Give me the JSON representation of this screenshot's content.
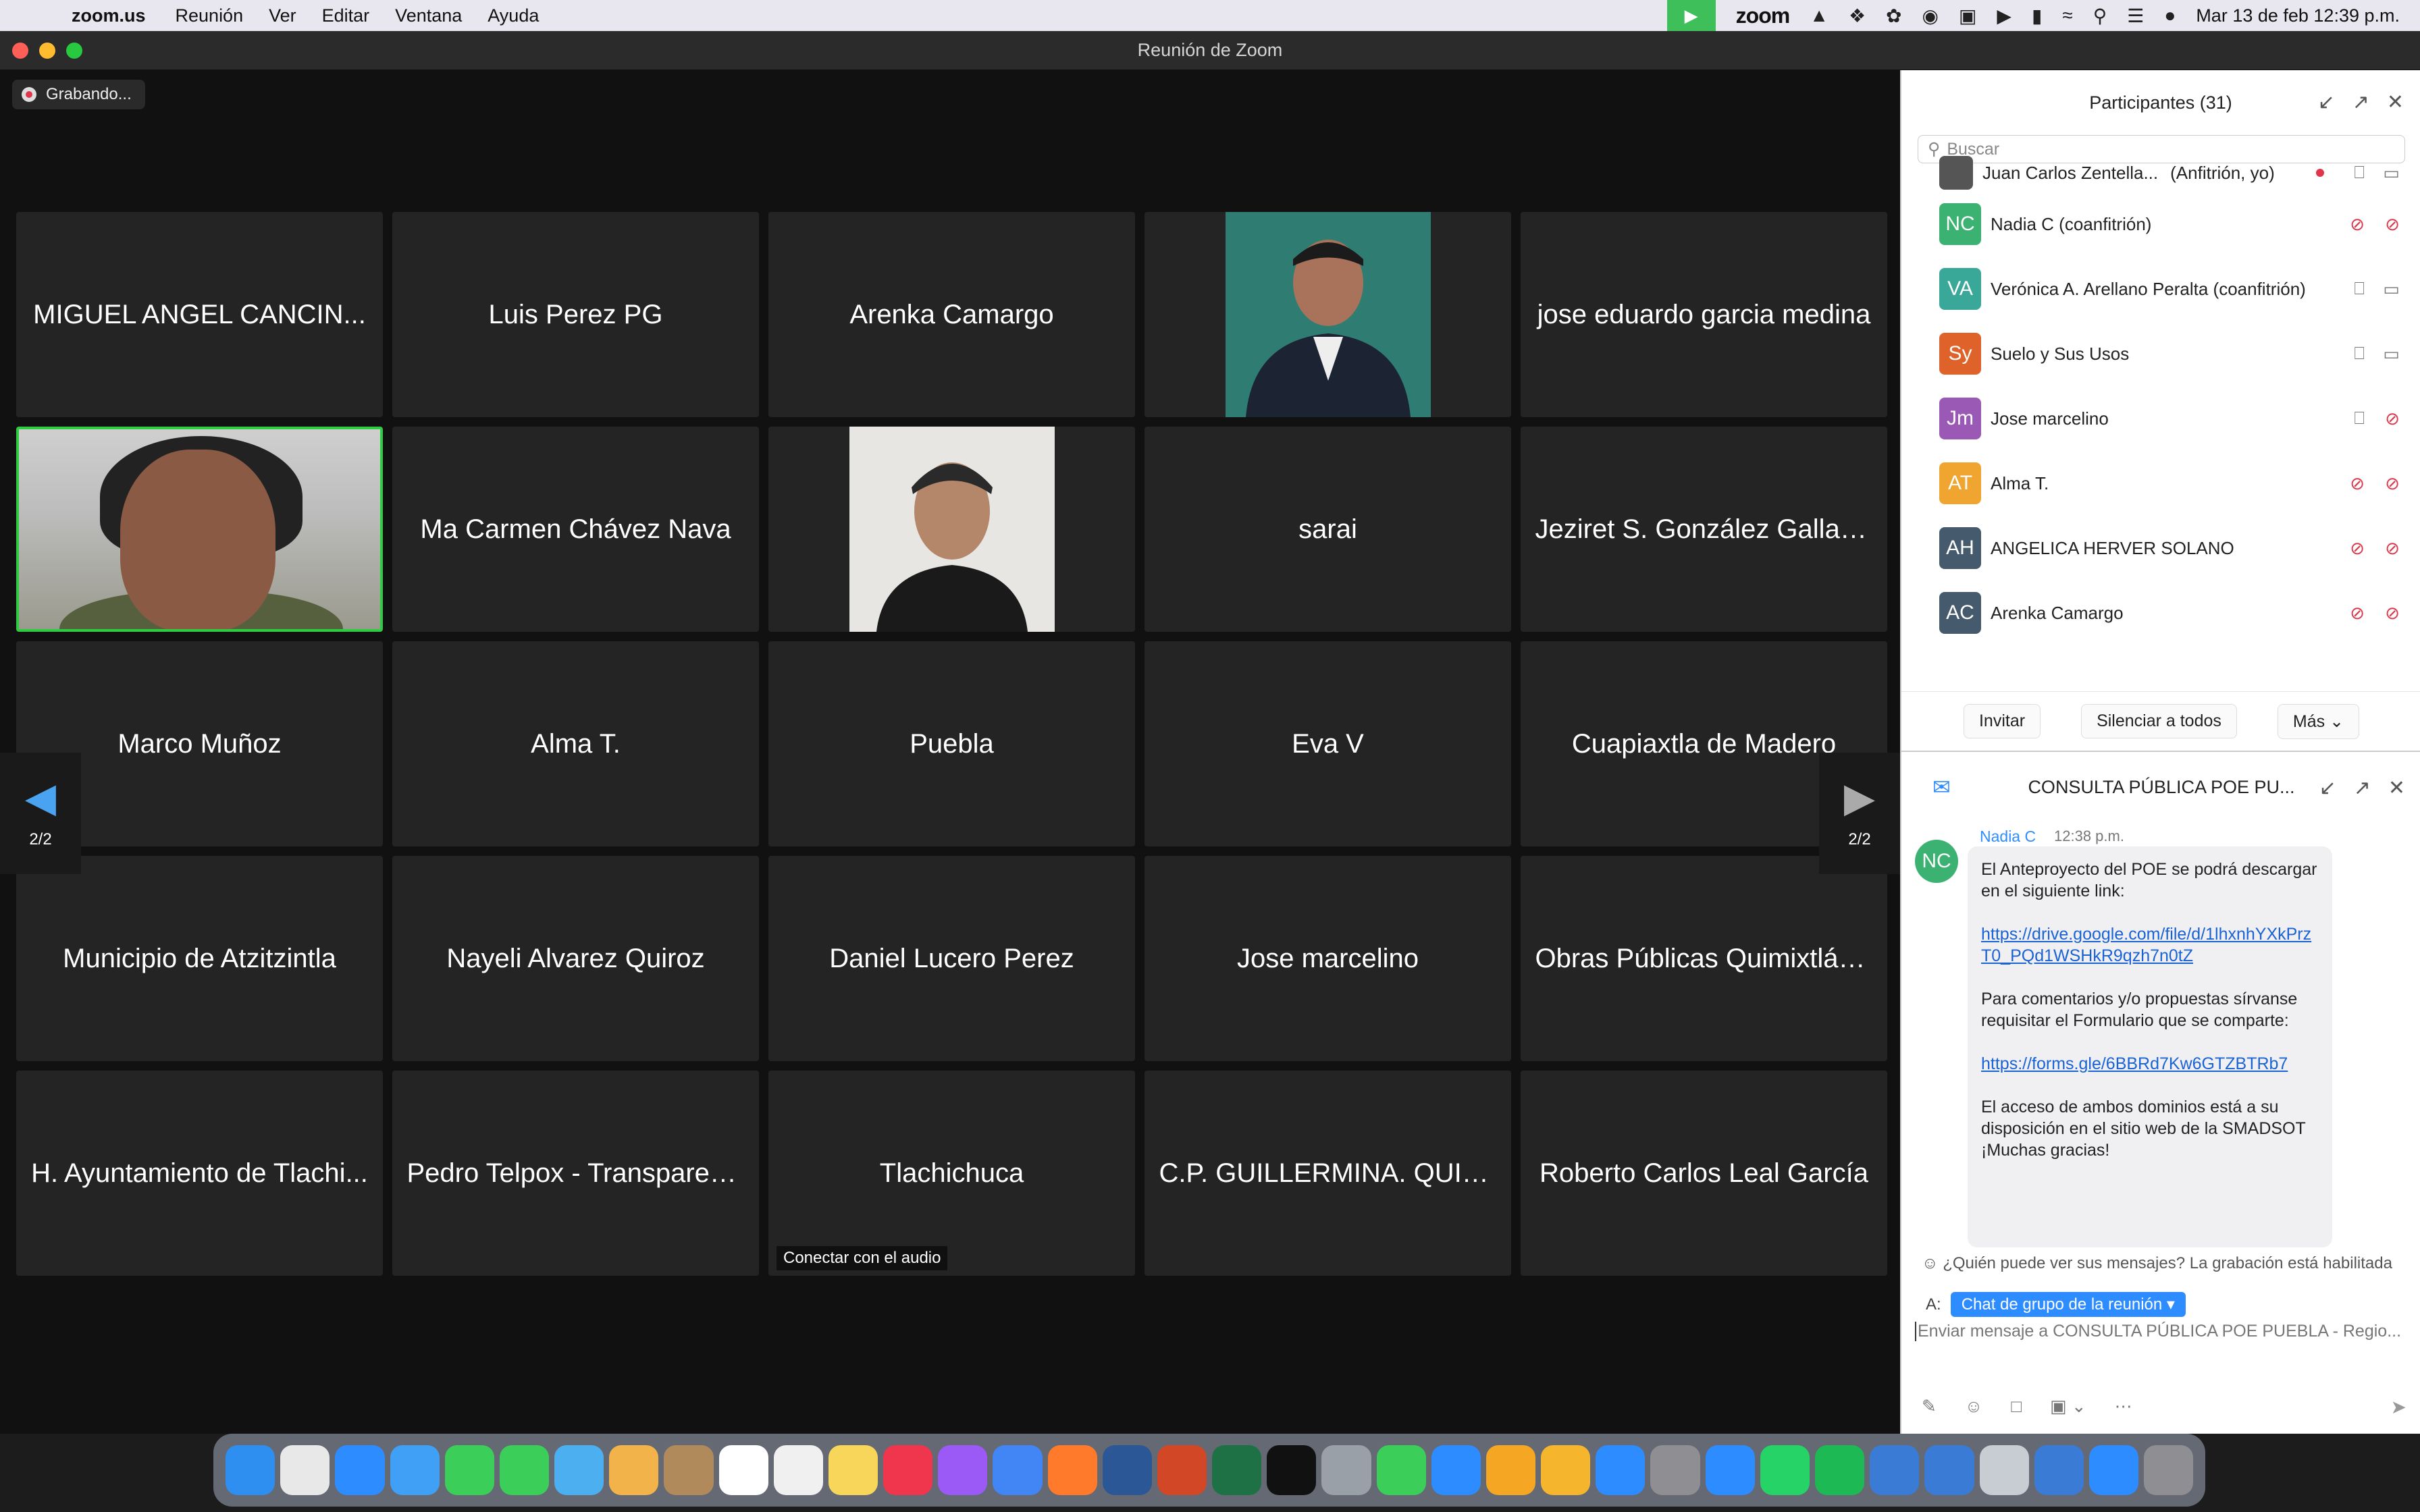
{
  "menubar": {
    "app": "zoom.us",
    "items": [
      "Reunión",
      "Ver",
      "Editar",
      "Ventana",
      "Ayuda"
    ],
    "zoom_word": "zoom",
    "clock": "Mar 13 de feb  12:39 p.m."
  },
  "window": {
    "title": "Reunión de Zoom"
  },
  "recording": {
    "label": "Grabando..."
  },
  "gallery": {
    "page_left": "2/2",
    "page_right": "2/2",
    "audio_badge": "Conectar con el audio",
    "tiles": [
      {
        "name": "MIGUEL ANGEL CANCIN...",
        "type": "name"
      },
      {
        "name": "Luis Perez PG",
        "type": "name"
      },
      {
        "name": "Arenka Camargo",
        "type": "name"
      },
      {
        "name": "",
        "type": "photo-suit"
      },
      {
        "name": "jose eduardo garcia medina",
        "type": "name"
      },
      {
        "name": "",
        "type": "video"
      },
      {
        "name": "Ma Carmen Chávez Nava",
        "type": "name"
      },
      {
        "name": "",
        "type": "photo-portrait"
      },
      {
        "name": "sarai",
        "type": "name"
      },
      {
        "name": "Jeziret S. González Gallardo",
        "type": "name"
      },
      {
        "name": "Marco Muñoz",
        "type": "name"
      },
      {
        "name": "Alma T.",
        "type": "name"
      },
      {
        "name": "Puebla",
        "type": "name"
      },
      {
        "name": "Eva V",
        "type": "name"
      },
      {
        "name": "Cuapiaxtla de Madero",
        "type": "name"
      },
      {
        "name": "Municipio de Atzitzintla",
        "type": "name"
      },
      {
        "name": "Nayeli Alvarez Quiroz",
        "type": "name"
      },
      {
        "name": "Daniel Lucero Perez",
        "type": "name"
      },
      {
        "name": "Jose marcelino",
        "type": "name"
      },
      {
        "name": "Obras Públicas Quimixtlán...",
        "type": "name"
      },
      {
        "name": "H. Ayuntamiento de Tlachi...",
        "type": "name"
      },
      {
        "name": "Pedro Telpox - Transparen...",
        "type": "name"
      },
      {
        "name": "Tlachichuca",
        "type": "name"
      },
      {
        "name": "C.P. GUILLERMINA. QUIMI...",
        "type": "name"
      },
      {
        "name": "Roberto Carlos Leal García",
        "type": "name"
      }
    ]
  },
  "participants": {
    "title": "Participantes (31)",
    "search_placeholder": "Buscar",
    "list": [
      {
        "initials": "",
        "name": "Juan Carlos Zentella...",
        "tag": "(Anfitrión, yo)",
        "color": "#555555",
        "mic_muted": false,
        "cam_off": false
      },
      {
        "initials": "NC",
        "name": "Nadia C (coanfitrión)",
        "tag": "",
        "color": "#3bb271",
        "mic_muted": true,
        "cam_off": true
      },
      {
        "initials": "VA",
        "name": "Verónica A. Arellano Peralta (coanfitrión)",
        "tag": "",
        "color": "#3aa898",
        "mic_muted": false,
        "cam_off": false
      },
      {
        "initials": "Sy",
        "name": "Suelo y Sus Usos",
        "tag": "",
        "color": "#e0622b",
        "mic_muted": false,
        "cam_off": false
      },
      {
        "initials": "Jm",
        "name": "Jose marcelino",
        "tag": "",
        "color": "#9b59b6",
        "mic_muted": false,
        "cam_off": true
      },
      {
        "initials": "AT",
        "name": "Alma T.",
        "tag": "",
        "color": "#f0a531",
        "mic_muted": true,
        "cam_off": true
      },
      {
        "initials": "AH",
        "name": "ANGELICA HERVER SOLANO",
        "tag": "",
        "color": "#465a6e",
        "mic_muted": true,
        "cam_off": true
      },
      {
        "initials": "AC",
        "name": "Arenka Camargo",
        "tag": "",
        "color": "#465a6e",
        "mic_muted": true,
        "cam_off": true
      }
    ],
    "invite": "Invitar",
    "mute_all": "Silenciar a todos",
    "more": "Más"
  },
  "chat": {
    "title": "CONSULTA PÚBLICA POE PU...",
    "sender": "Nadia C",
    "sender_initials": "NC",
    "time": "12:38 p.m.",
    "p1": "El Anteproyecto del POE se podrá descargar en el siguiente link:",
    "link1": "https://drive.google.com/file/d/1lhxnhYXkPrzT0_PQd1WSHkR9qzh7n0tZ",
    "p2": "Para comentarios y/o propuestas sírvanse requisitar el Formulario que se comparte:",
    "link2": "https://forms.gle/6BBRd7Kw6GTZBTRb7",
    "p3": "El acceso de ambos dominios está a su disposición en el sitio web de la SMADSOT",
    "p4": "¡Muchas gracias!",
    "visibility": "¿Quién puede ver sus mensajes? La grabación está habilitada",
    "to_label": "A:",
    "to_value": "Chat de grupo de la reunión",
    "input_placeholder": "Enviar mensaje a CONSULTA PÚBLICA POE PUEBLA -  Regio..."
  }
}
